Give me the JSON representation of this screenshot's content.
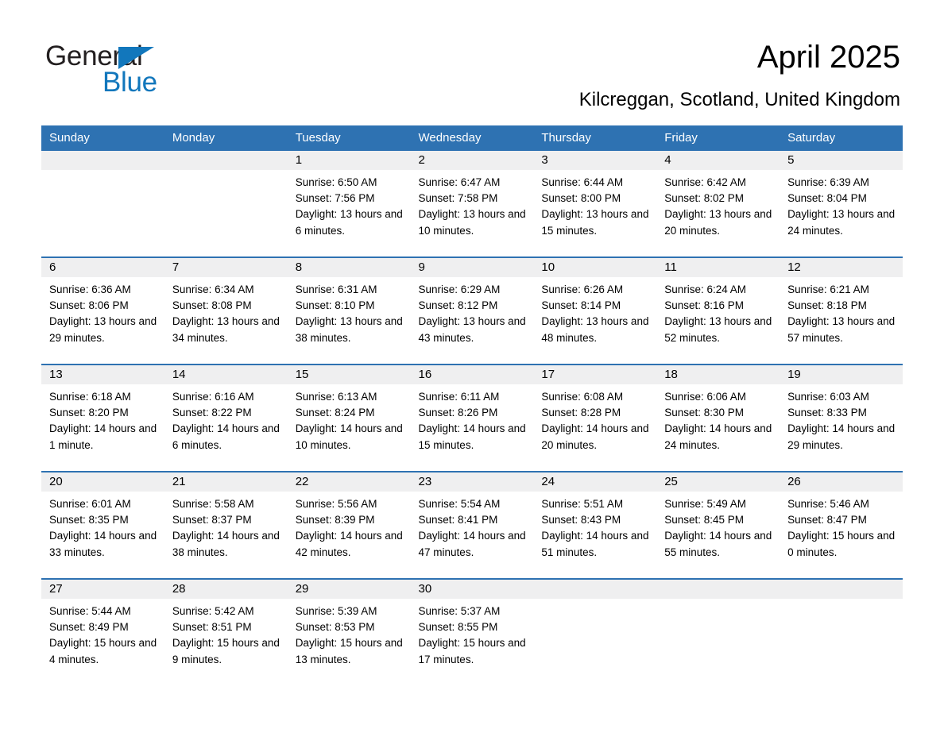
{
  "brand": {
    "name_part1": "General",
    "name_part2": "Blue",
    "triangle_color": "#1277bc"
  },
  "header": {
    "title": "April 2025",
    "subtitle": "Kilcreggan, Scotland, United Kingdom"
  },
  "theme": {
    "header_blue": "#2e72b2",
    "daynum_band": "#efeff0",
    "text": "#000000"
  },
  "weekdays": [
    "Sunday",
    "Monday",
    "Tuesday",
    "Wednesday",
    "Thursday",
    "Friday",
    "Saturday"
  ],
  "weeks": [
    [
      {
        "day": "",
        "sunrise": "",
        "sunset": "",
        "daylight": "",
        "empty": true
      },
      {
        "day": "",
        "sunrise": "",
        "sunset": "",
        "daylight": "",
        "empty": true
      },
      {
        "day": "1",
        "sunrise": "Sunrise: 6:50 AM",
        "sunset": "Sunset: 7:56 PM",
        "daylight": "Daylight: 13 hours and 6 minutes."
      },
      {
        "day": "2",
        "sunrise": "Sunrise: 6:47 AM",
        "sunset": "Sunset: 7:58 PM",
        "daylight": "Daylight: 13 hours and 10 minutes."
      },
      {
        "day": "3",
        "sunrise": "Sunrise: 6:44 AM",
        "sunset": "Sunset: 8:00 PM",
        "daylight": "Daylight: 13 hours and 15 minutes."
      },
      {
        "day": "4",
        "sunrise": "Sunrise: 6:42 AM",
        "sunset": "Sunset: 8:02 PM",
        "daylight": "Daylight: 13 hours and 20 minutes."
      },
      {
        "day": "5",
        "sunrise": "Sunrise: 6:39 AM",
        "sunset": "Sunset: 8:04 PM",
        "daylight": "Daylight: 13 hours and 24 minutes."
      }
    ],
    [
      {
        "day": "6",
        "sunrise": "Sunrise: 6:36 AM",
        "sunset": "Sunset: 8:06 PM",
        "daylight": "Daylight: 13 hours and 29 minutes."
      },
      {
        "day": "7",
        "sunrise": "Sunrise: 6:34 AM",
        "sunset": "Sunset: 8:08 PM",
        "daylight": "Daylight: 13 hours and 34 minutes."
      },
      {
        "day": "8",
        "sunrise": "Sunrise: 6:31 AM",
        "sunset": "Sunset: 8:10 PM",
        "daylight": "Daylight: 13 hours and 38 minutes."
      },
      {
        "day": "9",
        "sunrise": "Sunrise: 6:29 AM",
        "sunset": "Sunset: 8:12 PM",
        "daylight": "Daylight: 13 hours and 43 minutes."
      },
      {
        "day": "10",
        "sunrise": "Sunrise: 6:26 AM",
        "sunset": "Sunset: 8:14 PM",
        "daylight": "Daylight: 13 hours and 48 minutes."
      },
      {
        "day": "11",
        "sunrise": "Sunrise: 6:24 AM",
        "sunset": "Sunset: 8:16 PM",
        "daylight": "Daylight: 13 hours and 52 minutes."
      },
      {
        "day": "12",
        "sunrise": "Sunrise: 6:21 AM",
        "sunset": "Sunset: 8:18 PM",
        "daylight": "Daylight: 13 hours and 57 minutes."
      }
    ],
    [
      {
        "day": "13",
        "sunrise": "Sunrise: 6:18 AM",
        "sunset": "Sunset: 8:20 PM",
        "daylight": "Daylight: 14 hours and 1 minute."
      },
      {
        "day": "14",
        "sunrise": "Sunrise: 6:16 AM",
        "sunset": "Sunset: 8:22 PM",
        "daylight": "Daylight: 14 hours and 6 minutes."
      },
      {
        "day": "15",
        "sunrise": "Sunrise: 6:13 AM",
        "sunset": "Sunset: 8:24 PM",
        "daylight": "Daylight: 14 hours and 10 minutes."
      },
      {
        "day": "16",
        "sunrise": "Sunrise: 6:11 AM",
        "sunset": "Sunset: 8:26 PM",
        "daylight": "Daylight: 14 hours and 15 minutes."
      },
      {
        "day": "17",
        "sunrise": "Sunrise: 6:08 AM",
        "sunset": "Sunset: 8:28 PM",
        "daylight": "Daylight: 14 hours and 20 minutes."
      },
      {
        "day": "18",
        "sunrise": "Sunrise: 6:06 AM",
        "sunset": "Sunset: 8:30 PM",
        "daylight": "Daylight: 14 hours and 24 minutes."
      },
      {
        "day": "19",
        "sunrise": "Sunrise: 6:03 AM",
        "sunset": "Sunset: 8:33 PM",
        "daylight": "Daylight: 14 hours and 29 minutes."
      }
    ],
    [
      {
        "day": "20",
        "sunrise": "Sunrise: 6:01 AM",
        "sunset": "Sunset: 8:35 PM",
        "daylight": "Daylight: 14 hours and 33 minutes."
      },
      {
        "day": "21",
        "sunrise": "Sunrise: 5:58 AM",
        "sunset": "Sunset: 8:37 PM",
        "daylight": "Daylight: 14 hours and 38 minutes."
      },
      {
        "day": "22",
        "sunrise": "Sunrise: 5:56 AM",
        "sunset": "Sunset: 8:39 PM",
        "daylight": "Daylight: 14 hours and 42 minutes."
      },
      {
        "day": "23",
        "sunrise": "Sunrise: 5:54 AM",
        "sunset": "Sunset: 8:41 PM",
        "daylight": "Daylight: 14 hours and 47 minutes."
      },
      {
        "day": "24",
        "sunrise": "Sunrise: 5:51 AM",
        "sunset": "Sunset: 8:43 PM",
        "daylight": "Daylight: 14 hours and 51 minutes."
      },
      {
        "day": "25",
        "sunrise": "Sunrise: 5:49 AM",
        "sunset": "Sunset: 8:45 PM",
        "daylight": "Daylight: 14 hours and 55 minutes."
      },
      {
        "day": "26",
        "sunrise": "Sunrise: 5:46 AM",
        "sunset": "Sunset: 8:47 PM",
        "daylight": "Daylight: 15 hours and 0 minutes."
      }
    ],
    [
      {
        "day": "27",
        "sunrise": "Sunrise: 5:44 AM",
        "sunset": "Sunset: 8:49 PM",
        "daylight": "Daylight: 15 hours and 4 minutes."
      },
      {
        "day": "28",
        "sunrise": "Sunrise: 5:42 AM",
        "sunset": "Sunset: 8:51 PM",
        "daylight": "Daylight: 15 hours and 9 minutes."
      },
      {
        "day": "29",
        "sunrise": "Sunrise: 5:39 AM",
        "sunset": "Sunset: 8:53 PM",
        "daylight": "Daylight: 15 hours and 13 minutes."
      },
      {
        "day": "30",
        "sunrise": "Sunrise: 5:37 AM",
        "sunset": "Sunset: 8:55 PM",
        "daylight": "Daylight: 15 hours and 17 minutes."
      },
      {
        "day": "",
        "sunrise": "",
        "sunset": "",
        "daylight": "",
        "empty": true
      },
      {
        "day": "",
        "sunrise": "",
        "sunset": "",
        "daylight": "",
        "empty": true
      },
      {
        "day": "",
        "sunrise": "",
        "sunset": "",
        "daylight": "",
        "empty": true
      }
    ]
  ]
}
